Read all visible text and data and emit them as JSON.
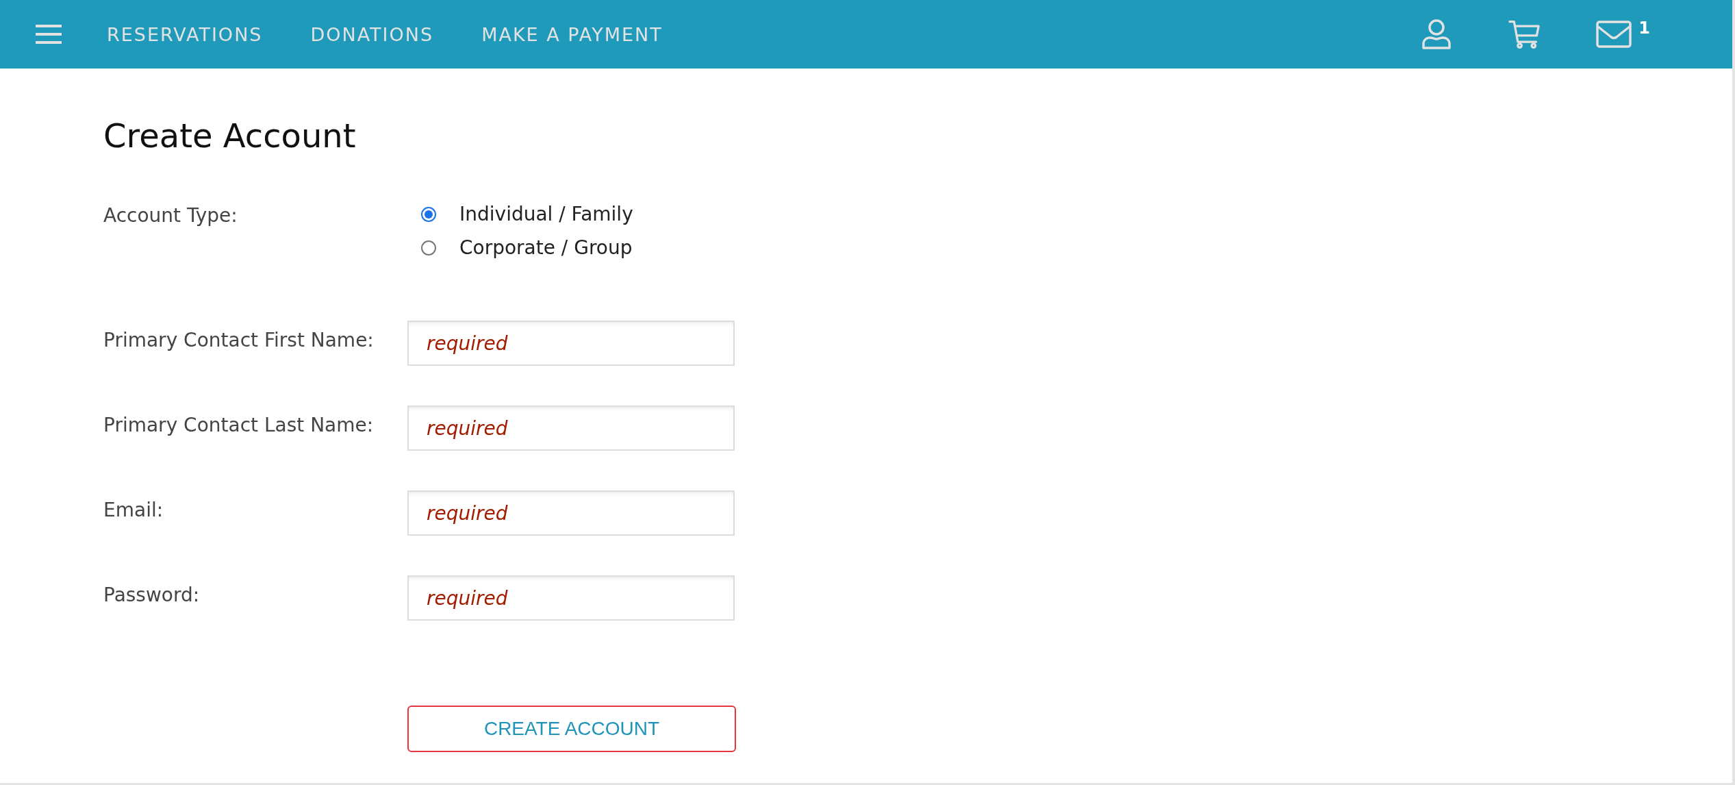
{
  "nav": {
    "items": [
      {
        "label": "RESERVATIONS"
      },
      {
        "label": "DONATIONS"
      },
      {
        "label": "MAKE A PAYMENT"
      }
    ],
    "message_count": "1"
  },
  "title": "Create Account",
  "account_type": {
    "label": "Account Type:",
    "options": [
      {
        "label": "Individual / Family",
        "selected": true
      },
      {
        "label": "Corporate / Group",
        "selected": false
      }
    ]
  },
  "fields": [
    {
      "label": "Primary Contact First Name:",
      "placeholder": "required"
    },
    {
      "label": "Primary Contact Last Name:",
      "placeholder": "required"
    },
    {
      "label": "Email:",
      "placeholder": "required"
    },
    {
      "label": "Password:",
      "placeholder": "required"
    }
  ],
  "submit": {
    "label": "CREATE ACCOUNT"
  }
}
